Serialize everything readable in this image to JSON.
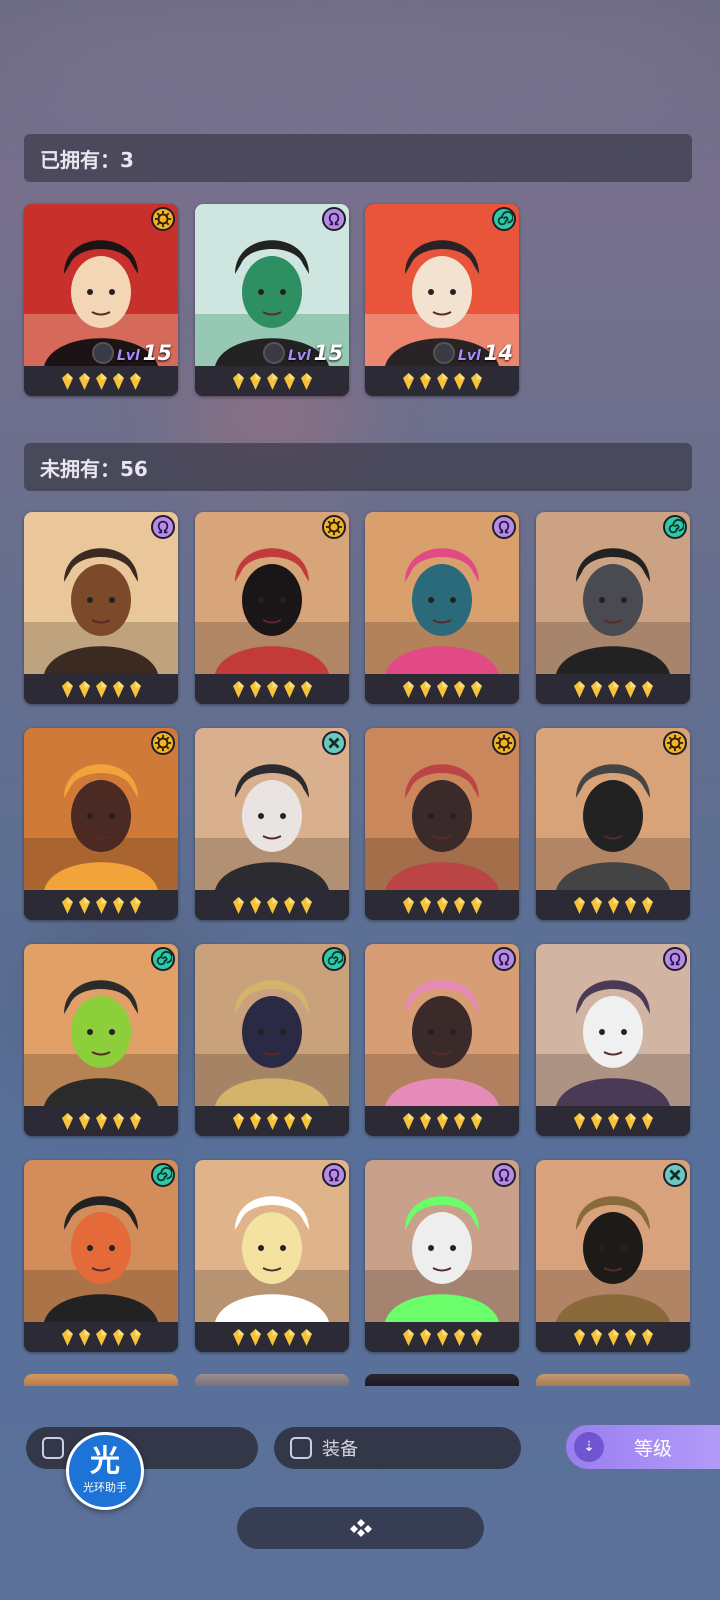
{
  "owned_section": {
    "label": "已拥有：3"
  },
  "unowned_section": {
    "label": "未拥有：56"
  },
  "owned_heroes": [
    {
      "level_label": "Lvl",
      "level": "15",
      "faction": "sun",
      "faction_color": "#f0b323",
      "stars": 5
    },
    {
      "level_label": "Lvl",
      "level": "15",
      "faction": "omega",
      "faction_color": "#b58ae8",
      "stars": 5
    },
    {
      "level_label": "Lvl",
      "level": "14",
      "faction": "spiral",
      "faction_color": "#2fc9a8",
      "stars": 5
    }
  ],
  "unowned_heroes": [
    {
      "faction": "omega",
      "stars": 5
    },
    {
      "faction": "sun",
      "stars": 5
    },
    {
      "faction": "omega",
      "stars": 5
    },
    {
      "faction": "spiral",
      "stars": 5
    },
    {
      "faction": "sun",
      "stars": 5
    },
    {
      "faction": "cross",
      "stars": 5
    },
    {
      "faction": "sun",
      "stars": 5
    },
    {
      "faction": "sun",
      "stars": 5
    },
    {
      "faction": "spiral",
      "stars": 5
    },
    {
      "faction": "spiral",
      "stars": 5
    },
    {
      "faction": "omega",
      "stars": 5
    },
    {
      "faction": "omega",
      "stars": 5
    },
    {
      "faction": "spiral",
      "stars": 5
    },
    {
      "faction": "omega",
      "stars": 5
    },
    {
      "faction": "omega",
      "stars": 5
    },
    {
      "faction": "cross",
      "stars": 5
    }
  ],
  "faction_colors": {
    "sun": "#f0b323",
    "omega": "#b58ae8",
    "spiral": "#2fc9a8",
    "cross": "#6cc7c0"
  },
  "filters": {
    "equipment_label": "装备",
    "level_sort_label": "等级"
  },
  "assistant": {
    "glyph": "光",
    "caption": "光环助手"
  },
  "star_color": "#f5c23a"
}
